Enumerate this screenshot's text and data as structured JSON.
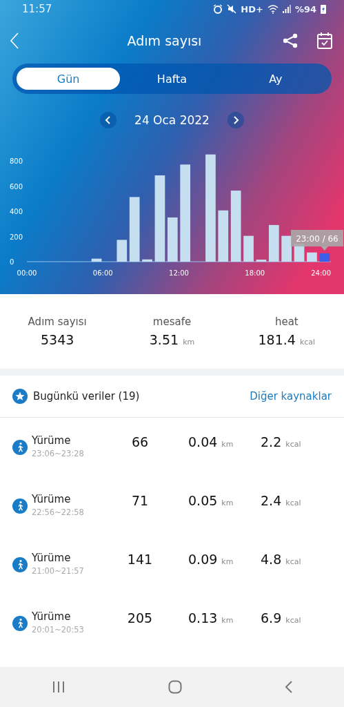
{
  "status_bar": {
    "time": "11:57",
    "network": "HD+",
    "battery": "%94"
  },
  "header": {
    "title": "Adım sayısı"
  },
  "tabs": [
    {
      "label": "Gün",
      "selected": true
    },
    {
      "label": "Hafta",
      "selected": false
    },
    {
      "label": "Ay",
      "selected": false
    }
  ],
  "date_nav": {
    "date": "24 Oca 2022"
  },
  "chart": {
    "tooltip": "23:00 / 66",
    "chart_data": {
      "type": "bar",
      "x": [
        5.5,
        7.5,
        8.5,
        9.5,
        10.5,
        11.5,
        12.5,
        14.5,
        15.5,
        16.5,
        17.5,
        18.5,
        19.5,
        20.5,
        21.5,
        22.5,
        23.5
      ],
      "values": [
        24,
        173,
        513,
        18,
        685,
        351,
        771,
        851,
        407,
        564,
        205,
        16,
        291,
        205,
        141,
        73,
        66
      ],
      "xlim": [
        0,
        24
      ],
      "ylim": [
        0,
        851
      ],
      "xticks": [
        {
          "value": 0,
          "label": "00:00"
        },
        {
          "value": 6,
          "label": "06:00"
        },
        {
          "value": 12,
          "label": "12:00"
        },
        {
          "value": 18,
          "label": "18:00"
        },
        {
          "value": 24,
          "label": "24:00"
        }
      ],
      "yticks": [
        0,
        200,
        400,
        600,
        800
      ]
    }
  },
  "summary": [
    {
      "label": "Adım sayısı",
      "value": "5343"
    },
    {
      "label": "mesafe",
      "value": "3.51",
      "unit": "km"
    },
    {
      "label": "heat",
      "value": "181.4",
      "unit": "kcal"
    }
  ],
  "records": {
    "title": "Bugünkü veriler (19)",
    "link": "Diğer kaynaklar",
    "rows": [
      {
        "activity": "Yürüme",
        "time": "23:06~23:28",
        "steps": "66",
        "distance": "0.04",
        "distance_unit": "km",
        "energy": "2.2",
        "energy_unit": "kcal"
      },
      {
        "activity": "Yürüme",
        "time": "22:56~22:58",
        "steps": "71",
        "distance": "0.05",
        "distance_unit": "km",
        "energy": "2.4",
        "energy_unit": "kcal"
      },
      {
        "activity": "Yürüme",
        "time": "21:00~21:57",
        "steps": "141",
        "distance": "0.09",
        "distance_unit": "km",
        "energy": "4.8",
        "energy_unit": "kcal"
      },
      {
        "activity": "Yürüme",
        "time": "20:01~20:53",
        "steps": "205",
        "distance": "0.13",
        "distance_unit": "km",
        "energy": "6.9",
        "energy_unit": "kcal"
      }
    ]
  }
}
